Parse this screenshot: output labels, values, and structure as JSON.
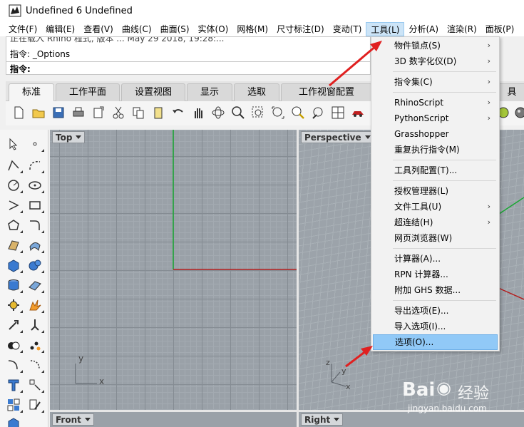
{
  "window": {
    "title": "Undefined 6 Undefined"
  },
  "menubar": {
    "items": [
      "文件(F)",
      "编辑(E)",
      "查看(V)",
      "曲线(C)",
      "曲面(S)",
      "实体(O)",
      "网格(M)",
      "尺寸标注(D)",
      "变动(T)",
      "工具(L)",
      "分析(A)",
      "渲染(R)",
      "面板(P)"
    ],
    "active": "工具(L)"
  },
  "command": {
    "history_cut": "正在载入 Rhino 程式, 版本 ... May 29 2018, 19:28:...",
    "last": "指令: _Options",
    "prompt": "指令:"
  },
  "tabs": [
    "标准",
    "工作平面",
    "设置视图",
    "显示",
    "选取",
    "工作视窗配置",
    "具"
  ],
  "active_tab": "标准",
  "viewports": {
    "top": "Top",
    "perspective": "Perspective",
    "front": "Front",
    "right": "Right",
    "axis_x": "x",
    "axis_y": "y",
    "axis_z": "z"
  },
  "tools_menu": {
    "items": [
      {
        "label": "物件锁点(S)",
        "submenu": true
      },
      {
        "label": "3D 数字化仪(D)",
        "submenu": true
      },
      {
        "label": "指令集(C)",
        "submenu": true
      },
      {
        "label": "RhinoScript",
        "submenu": true
      },
      {
        "label": "PythonScript",
        "submenu": true
      },
      {
        "label": "Grasshopper",
        "submenu": false
      },
      {
        "label": "重复执行指令(M)",
        "submenu": false
      },
      {
        "label": "工具列配置(T)...",
        "submenu": false
      },
      {
        "label": "授权管理器(L)",
        "submenu": false
      },
      {
        "label": "文件工具(U)",
        "submenu": true
      },
      {
        "label": "超连结(H)",
        "submenu": true
      },
      {
        "label": "网页浏览器(W)",
        "submenu": false
      },
      {
        "label": "计算器(A)...",
        "submenu": false
      },
      {
        "label": "RPN 计算器...",
        "submenu": false
      },
      {
        "label": "附加 GHS 数据...",
        "submenu": false
      },
      {
        "label": "导出选项(E)...",
        "submenu": false
      },
      {
        "label": "导入选项(I)...",
        "submenu": false
      },
      {
        "label": "选项(O)...",
        "submenu": false
      }
    ],
    "highlighted": "选项(O)...",
    "submenu_glyph": "›"
  },
  "watermark": {
    "brand": "Bai",
    "brand_suffix": "经验",
    "url": "jingyan.baidu.com"
  },
  "colors": {
    "accent_highlight": "#91c9f7",
    "arrow": "#e02020",
    "axis_green": "#19a832",
    "axis_red": "#b41e1e"
  }
}
